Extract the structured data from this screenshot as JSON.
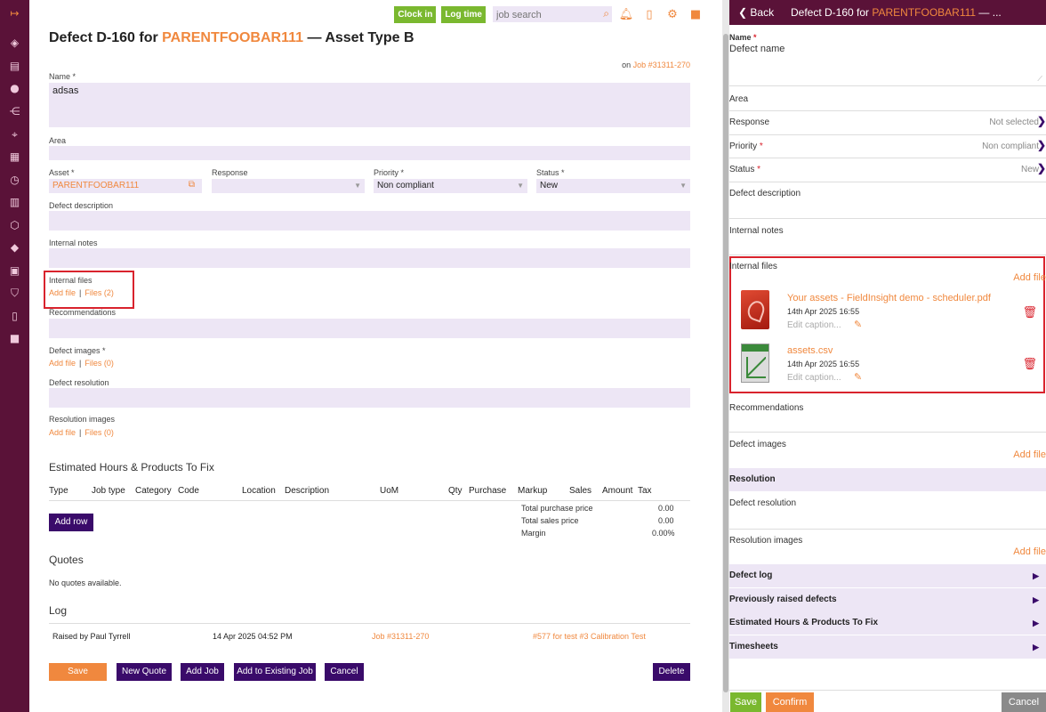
{
  "topbar": {
    "clock_in": "Clock in",
    "log_time": "Log time",
    "search_placeholder": "job search"
  },
  "page": {
    "title_prefix": "Defect D-160 for ",
    "title_asset": "PARENTFOOBAR111",
    "title_suffix": " — Asset Type B",
    "on_label": "on ",
    "job_link": "Job #31311-270"
  },
  "form": {
    "name_label": "Name *",
    "name_value": "adsas",
    "area_label": "Area",
    "asset_label": "Asset *",
    "asset_value": "PARENTFOOBAR111",
    "response_label": "Response",
    "response_value": "",
    "priority_label": "Priority *",
    "priority_value": "Non compliant",
    "status_label": "Status *",
    "status_value": "New",
    "defect_description_label": "Defect description",
    "internal_notes_label": "Internal notes",
    "internal_files_label": "Internal files",
    "internal_add": "Add file",
    "internal_files": "Files (2)",
    "recommendations_label": "Recommendations",
    "defect_images_label": "Defect images *",
    "images_add": "Add file",
    "images_files": "Files (0)",
    "defect_resolution_label": "Defect resolution",
    "resolution_images_label": "Resolution images",
    "res_add": "Add file",
    "res_files": "Files (0)",
    "separator": "|"
  },
  "estimate": {
    "title": "Estimated Hours & Products To Fix",
    "columns": [
      "Type",
      "Job type",
      "Category",
      "Code",
      "Location",
      "Description",
      "UoM",
      "Qty",
      "Purchase",
      "Markup",
      "Sales",
      "Amount",
      "Tax"
    ],
    "add_row": "Add row",
    "total_purchase_label": "Total purchase price",
    "total_purchase": "0.00",
    "total_sales_label": "Total sales price",
    "total_sales": "0.00",
    "margin_label": "Margin",
    "margin": "0.00%"
  },
  "quotes": {
    "title": "Quotes",
    "empty": "No quotes available."
  },
  "log": {
    "title": "Log",
    "raised_by": "Raised by Paul Tyrrell",
    "date": "14 Apr 2025 04:52 PM",
    "job": "Job #31311-270",
    "ref": "#577 for test #3 Calibration Test"
  },
  "buttons": {
    "save": "Save",
    "new_quote": "New Quote",
    "add_job": "Add Job",
    "add_existing": "Add to Existing Job",
    "cancel": "Cancel",
    "delete": "Delete"
  },
  "right": {
    "back": "Back",
    "title_prefix": "Defect D-160 for ",
    "title_asset": "PARENTFOOBAR111",
    "title_suffix": " — ...",
    "name_label": "Name",
    "req": "*",
    "name_placeholder": "Defect name",
    "area_label": "Area",
    "response_label": "Response",
    "response_value": "Not selected",
    "priority_label": "Priority",
    "priority_value": "Non compliant",
    "status_label": "Status",
    "status_value": "New",
    "defect_description_label": "Defect description",
    "internal_notes_label": "Internal notes",
    "internal_files_label": "Internal files",
    "add_file": "Add file",
    "files": [
      {
        "name": "Your assets - FieldInsight demo - scheduler.pdf",
        "date": "14th Apr 2025 16:55",
        "caption": "Edit caption..."
      },
      {
        "name": "assets.csv",
        "date": "14th Apr 2025 16:55",
        "caption": "Edit caption..."
      }
    ],
    "recommendations_label": "Recommendations",
    "defect_images_label": "Defect images",
    "resolution_band": "Resolution",
    "defect_resolution_label": "Defect resolution",
    "resolution_images_label": "Resolution images",
    "defect_log": "Defect log",
    "previously_raised": "Previously raised defects",
    "estimated": "Estimated Hours & Products To Fix",
    "timesheets": "Timesheets",
    "save": "Save",
    "confirm": "Confirm",
    "cancel": "Cancel"
  },
  "colors": {
    "brand": "#5a1238",
    "accent": "#f0883e",
    "purple": "#3a0b6a",
    "green": "#7ab82f",
    "field": "#ede6f5",
    "highlight": "#d9232d"
  }
}
